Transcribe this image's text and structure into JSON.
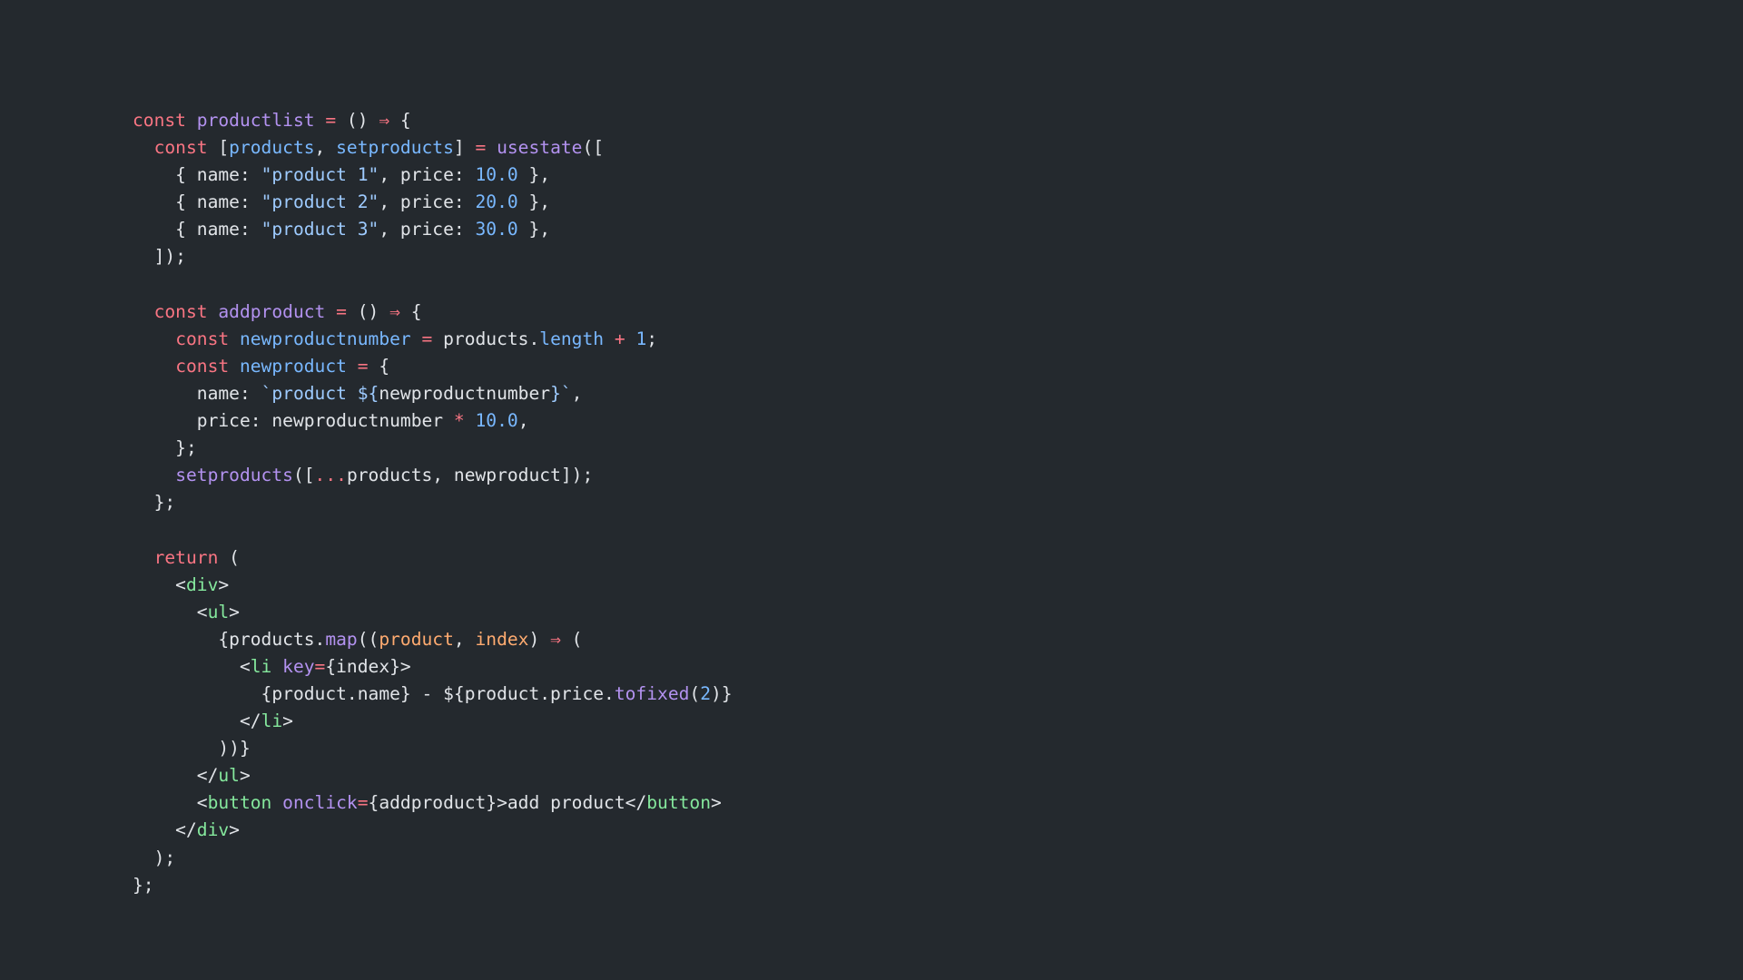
{
  "editor": {
    "background": "#24292e",
    "language": "jsx",
    "palette": {
      "keyword": "#f97583",
      "operator": "#f97583",
      "function": "#b392f0",
      "variable": "#79b8ff",
      "string": "#9ecbff",
      "number": "#79b8ff",
      "property": "#79b8ff",
      "parameter": "#ffab70",
      "tag": "#85e89d",
      "attribute": "#b392f0",
      "plain": "#e1e4e8"
    },
    "lines": [
      [
        [
          "kw",
          "const"
        ],
        [
          "plain",
          " "
        ],
        [
          "fn",
          "productlist"
        ],
        [
          "plain",
          " "
        ],
        [
          "op",
          "="
        ],
        [
          "plain",
          " () "
        ],
        [
          "op",
          "⇒"
        ],
        [
          "plain",
          " {"
        ]
      ],
      [
        [
          "plain",
          "  "
        ],
        [
          "kw",
          "const"
        ],
        [
          "plain",
          " ["
        ],
        [
          "var",
          "products"
        ],
        [
          "plain",
          ", "
        ],
        [
          "var",
          "setproducts"
        ],
        [
          "plain",
          "] "
        ],
        [
          "op",
          "="
        ],
        [
          "plain",
          " "
        ],
        [
          "fn",
          "usestate"
        ],
        [
          "plain",
          "(["
        ]
      ],
      [
        [
          "plain",
          "    { name: "
        ],
        [
          "str",
          "\"product 1\""
        ],
        [
          "plain",
          ", price: "
        ],
        [
          "num",
          "10.0"
        ],
        [
          "plain",
          " },"
        ]
      ],
      [
        [
          "plain",
          "    { name: "
        ],
        [
          "str",
          "\"product 2\""
        ],
        [
          "plain",
          ", price: "
        ],
        [
          "num",
          "20.0"
        ],
        [
          "plain",
          " },"
        ]
      ],
      [
        [
          "plain",
          "    { name: "
        ],
        [
          "str",
          "\"product 3\""
        ],
        [
          "plain",
          ", price: "
        ],
        [
          "num",
          "30.0"
        ],
        [
          "plain",
          " },"
        ]
      ],
      [
        [
          "plain",
          "  ]);"
        ]
      ],
      [],
      [
        [
          "plain",
          "  "
        ],
        [
          "kw",
          "const"
        ],
        [
          "plain",
          " "
        ],
        [
          "fn",
          "addproduct"
        ],
        [
          "plain",
          " "
        ],
        [
          "op",
          "="
        ],
        [
          "plain",
          " () "
        ],
        [
          "op",
          "⇒"
        ],
        [
          "plain",
          " {"
        ]
      ],
      [
        [
          "plain",
          "    "
        ],
        [
          "kw",
          "const"
        ],
        [
          "plain",
          " "
        ],
        [
          "var",
          "newproductnumber"
        ],
        [
          "plain",
          " "
        ],
        [
          "op",
          "="
        ],
        [
          "plain",
          " products."
        ],
        [
          "prop",
          "length"
        ],
        [
          "plain",
          " "
        ],
        [
          "op",
          "+"
        ],
        [
          "plain",
          " "
        ],
        [
          "num",
          "1"
        ],
        [
          "plain",
          ";"
        ]
      ],
      [
        [
          "plain",
          "    "
        ],
        [
          "kw",
          "const"
        ],
        [
          "plain",
          " "
        ],
        [
          "var",
          "newproduct"
        ],
        [
          "plain",
          " "
        ],
        [
          "op",
          "="
        ],
        [
          "plain",
          " {"
        ]
      ],
      [
        [
          "plain",
          "      name: "
        ],
        [
          "str",
          "`product ${"
        ],
        [
          "plain",
          "newproductnumber"
        ],
        [
          "str",
          "}`"
        ],
        [
          "plain",
          ","
        ]
      ],
      [
        [
          "plain",
          "      price: newproductnumber "
        ],
        [
          "op",
          "*"
        ],
        [
          "plain",
          " "
        ],
        [
          "num",
          "10.0"
        ],
        [
          "plain",
          ","
        ]
      ],
      [
        [
          "plain",
          "    };"
        ]
      ],
      [
        [
          "plain",
          "    "
        ],
        [
          "fn",
          "setproducts"
        ],
        [
          "plain",
          "(["
        ],
        [
          "op",
          "..."
        ],
        [
          "plain",
          "products, newproduct]);"
        ]
      ],
      [
        [
          "plain",
          "  };"
        ]
      ],
      [],
      [
        [
          "plain",
          "  "
        ],
        [
          "kw",
          "return"
        ],
        [
          "plain",
          " ("
        ]
      ],
      [
        [
          "plain",
          "    <"
        ],
        [
          "tag",
          "div"
        ],
        [
          "plain",
          ">"
        ]
      ],
      [
        [
          "plain",
          "      <"
        ],
        [
          "tag",
          "ul"
        ],
        [
          "plain",
          ">"
        ]
      ],
      [
        [
          "plain",
          "        {products."
        ],
        [
          "fn",
          "map"
        ],
        [
          "plain",
          "(("
        ],
        [
          "param",
          "product"
        ],
        [
          "plain",
          ", "
        ],
        [
          "param",
          "index"
        ],
        [
          "plain",
          ") "
        ],
        [
          "op",
          "⇒"
        ],
        [
          "plain",
          " ("
        ]
      ],
      [
        [
          "plain",
          "          <"
        ],
        [
          "tag",
          "li"
        ],
        [
          "plain",
          " "
        ],
        [
          "attr",
          "key"
        ],
        [
          "op",
          "="
        ],
        [
          "plain",
          "{index}>"
        ]
      ],
      [
        [
          "plain",
          "            {product.name} - ${product.price."
        ],
        [
          "fn",
          "tofixed"
        ],
        [
          "plain",
          "("
        ],
        [
          "num",
          "2"
        ],
        [
          "plain",
          ")}"
        ]
      ],
      [
        [
          "plain",
          "          </"
        ],
        [
          "tag",
          "li"
        ],
        [
          "plain",
          ">"
        ]
      ],
      [
        [
          "plain",
          "        ))}"
        ]
      ],
      [
        [
          "plain",
          "      </"
        ],
        [
          "tag",
          "ul"
        ],
        [
          "plain",
          ">"
        ]
      ],
      [
        [
          "plain",
          "      <"
        ],
        [
          "tag",
          "button"
        ],
        [
          "plain",
          " "
        ],
        [
          "attr",
          "onclick"
        ],
        [
          "op",
          "="
        ],
        [
          "plain",
          "{addproduct}>add product</"
        ],
        [
          "tag",
          "button"
        ],
        [
          "plain",
          ">"
        ]
      ],
      [
        [
          "plain",
          "    </"
        ],
        [
          "tag",
          "div"
        ],
        [
          "plain",
          ">"
        ]
      ],
      [
        [
          "plain",
          "  );"
        ]
      ],
      [
        [
          "plain",
          "};"
        ]
      ]
    ]
  }
}
